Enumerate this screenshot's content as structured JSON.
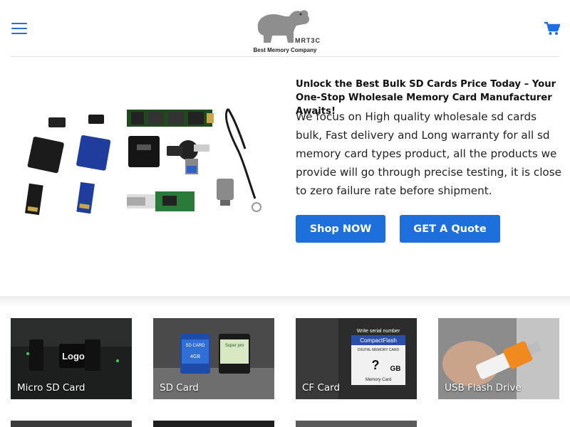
{
  "brand": {
    "mark_text": "MRT3C",
    "tagline": "Best Memory Company"
  },
  "hero": {
    "title": "Unlock the Best Bulk SD Cards Price Today – Your One-Stop Wholesale Memory Card Manufacturer Awaits!",
    "description": "We focus on High quality wholesale sd cards bulk, Fast delivery and Long warranty for all sd memory card types product, all the products we provide will go through precise testing, it is close to zero failure rate before shipment.",
    "shop_button": "Shop NOW",
    "quote_button": "GET A Quote"
  },
  "categories": [
    {
      "label": "Micro SD Card",
      "image_text": "Logo"
    },
    {
      "label": "SD Card",
      "image_text": [
        "SD CARD",
        "4GB",
        "Super pro"
      ]
    },
    {
      "label": "CF Card",
      "image_text": [
        "Write serial number",
        "CompactFlash",
        "DIGITAL MEMORY CARD",
        "?",
        "GB",
        "Memory Card"
      ]
    },
    {
      "label": "USB Flash Drive",
      "image_text": ""
    }
  ],
  "colors": {
    "accent": "#1d6fdc",
    "icon_blue": "#2a6fc9"
  },
  "icons": {
    "menu": "hamburger-menu-icon",
    "cart": "shopping-cart-icon"
  }
}
